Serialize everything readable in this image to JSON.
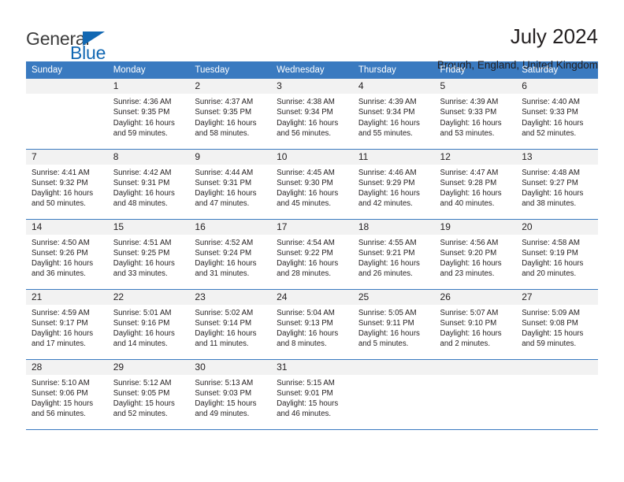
{
  "brand": {
    "name_part1": "General",
    "name_part2": "Blue",
    "triangle_color": "#1268b3"
  },
  "header": {
    "title": "July 2024",
    "subtitle": "Brough, England, United Kingdom"
  },
  "theme": {
    "header_blue": "#3a7ac0",
    "daynum_band": "#f2f2f2",
    "text": "#231f20"
  },
  "calendar": {
    "weekday_headers": [
      "Sunday",
      "Monday",
      "Tuesday",
      "Wednesday",
      "Thursday",
      "Friday",
      "Saturday"
    ],
    "labels": {
      "sunrise": "Sunrise:",
      "sunset": "Sunset:",
      "daylight": "Daylight:"
    },
    "weeks": [
      [
        {
          "day": "",
          "blank": true,
          "sunrise": "",
          "sunset": "",
          "daylight_line1": "",
          "daylight_line2": ""
        },
        {
          "day": "1",
          "blank": false,
          "sunrise": "Sunrise: 4:36 AM",
          "sunset": "Sunset: 9:35 PM",
          "daylight_line1": "Daylight: 16 hours",
          "daylight_line2": "and 59 minutes."
        },
        {
          "day": "2",
          "blank": false,
          "sunrise": "Sunrise: 4:37 AM",
          "sunset": "Sunset: 9:35 PM",
          "daylight_line1": "Daylight: 16 hours",
          "daylight_line2": "and 58 minutes."
        },
        {
          "day": "3",
          "blank": false,
          "sunrise": "Sunrise: 4:38 AM",
          "sunset": "Sunset: 9:34 PM",
          "daylight_line1": "Daylight: 16 hours",
          "daylight_line2": "and 56 minutes."
        },
        {
          "day": "4",
          "blank": false,
          "sunrise": "Sunrise: 4:39 AM",
          "sunset": "Sunset: 9:34 PM",
          "daylight_line1": "Daylight: 16 hours",
          "daylight_line2": "and 55 minutes."
        },
        {
          "day": "5",
          "blank": false,
          "sunrise": "Sunrise: 4:39 AM",
          "sunset": "Sunset: 9:33 PM",
          "daylight_line1": "Daylight: 16 hours",
          "daylight_line2": "and 53 minutes."
        },
        {
          "day": "6",
          "blank": false,
          "sunrise": "Sunrise: 4:40 AM",
          "sunset": "Sunset: 9:33 PM",
          "daylight_line1": "Daylight: 16 hours",
          "daylight_line2": "and 52 minutes."
        }
      ],
      [
        {
          "day": "7",
          "blank": false,
          "sunrise": "Sunrise: 4:41 AM",
          "sunset": "Sunset: 9:32 PM",
          "daylight_line1": "Daylight: 16 hours",
          "daylight_line2": "and 50 minutes."
        },
        {
          "day": "8",
          "blank": false,
          "sunrise": "Sunrise: 4:42 AM",
          "sunset": "Sunset: 9:31 PM",
          "daylight_line1": "Daylight: 16 hours",
          "daylight_line2": "and 48 minutes."
        },
        {
          "day": "9",
          "blank": false,
          "sunrise": "Sunrise: 4:44 AM",
          "sunset": "Sunset: 9:31 PM",
          "daylight_line1": "Daylight: 16 hours",
          "daylight_line2": "and 47 minutes."
        },
        {
          "day": "10",
          "blank": false,
          "sunrise": "Sunrise: 4:45 AM",
          "sunset": "Sunset: 9:30 PM",
          "daylight_line1": "Daylight: 16 hours",
          "daylight_line2": "and 45 minutes."
        },
        {
          "day": "11",
          "blank": false,
          "sunrise": "Sunrise: 4:46 AM",
          "sunset": "Sunset: 9:29 PM",
          "daylight_line1": "Daylight: 16 hours",
          "daylight_line2": "and 42 minutes."
        },
        {
          "day": "12",
          "blank": false,
          "sunrise": "Sunrise: 4:47 AM",
          "sunset": "Sunset: 9:28 PM",
          "daylight_line1": "Daylight: 16 hours",
          "daylight_line2": "and 40 minutes."
        },
        {
          "day": "13",
          "blank": false,
          "sunrise": "Sunrise: 4:48 AM",
          "sunset": "Sunset: 9:27 PM",
          "daylight_line1": "Daylight: 16 hours",
          "daylight_line2": "and 38 minutes."
        }
      ],
      [
        {
          "day": "14",
          "blank": false,
          "sunrise": "Sunrise: 4:50 AM",
          "sunset": "Sunset: 9:26 PM",
          "daylight_line1": "Daylight: 16 hours",
          "daylight_line2": "and 36 minutes."
        },
        {
          "day": "15",
          "blank": false,
          "sunrise": "Sunrise: 4:51 AM",
          "sunset": "Sunset: 9:25 PM",
          "daylight_line1": "Daylight: 16 hours",
          "daylight_line2": "and 33 minutes."
        },
        {
          "day": "16",
          "blank": false,
          "sunrise": "Sunrise: 4:52 AM",
          "sunset": "Sunset: 9:24 PM",
          "daylight_line1": "Daylight: 16 hours",
          "daylight_line2": "and 31 minutes."
        },
        {
          "day": "17",
          "blank": false,
          "sunrise": "Sunrise: 4:54 AM",
          "sunset": "Sunset: 9:22 PM",
          "daylight_line1": "Daylight: 16 hours",
          "daylight_line2": "and 28 minutes."
        },
        {
          "day": "18",
          "blank": false,
          "sunrise": "Sunrise: 4:55 AM",
          "sunset": "Sunset: 9:21 PM",
          "daylight_line1": "Daylight: 16 hours",
          "daylight_line2": "and 26 minutes."
        },
        {
          "day": "19",
          "blank": false,
          "sunrise": "Sunrise: 4:56 AM",
          "sunset": "Sunset: 9:20 PM",
          "daylight_line1": "Daylight: 16 hours",
          "daylight_line2": "and 23 minutes."
        },
        {
          "day": "20",
          "blank": false,
          "sunrise": "Sunrise: 4:58 AM",
          "sunset": "Sunset: 9:19 PM",
          "daylight_line1": "Daylight: 16 hours",
          "daylight_line2": "and 20 minutes."
        }
      ],
      [
        {
          "day": "21",
          "blank": false,
          "sunrise": "Sunrise: 4:59 AM",
          "sunset": "Sunset: 9:17 PM",
          "daylight_line1": "Daylight: 16 hours",
          "daylight_line2": "and 17 minutes."
        },
        {
          "day": "22",
          "blank": false,
          "sunrise": "Sunrise: 5:01 AM",
          "sunset": "Sunset: 9:16 PM",
          "daylight_line1": "Daylight: 16 hours",
          "daylight_line2": "and 14 minutes."
        },
        {
          "day": "23",
          "blank": false,
          "sunrise": "Sunrise: 5:02 AM",
          "sunset": "Sunset: 9:14 PM",
          "daylight_line1": "Daylight: 16 hours",
          "daylight_line2": "and 11 minutes."
        },
        {
          "day": "24",
          "blank": false,
          "sunrise": "Sunrise: 5:04 AM",
          "sunset": "Sunset: 9:13 PM",
          "daylight_line1": "Daylight: 16 hours",
          "daylight_line2": "and 8 minutes."
        },
        {
          "day": "25",
          "blank": false,
          "sunrise": "Sunrise: 5:05 AM",
          "sunset": "Sunset: 9:11 PM",
          "daylight_line1": "Daylight: 16 hours",
          "daylight_line2": "and 5 minutes."
        },
        {
          "day": "26",
          "blank": false,
          "sunrise": "Sunrise: 5:07 AM",
          "sunset": "Sunset: 9:10 PM",
          "daylight_line1": "Daylight: 16 hours",
          "daylight_line2": "and 2 minutes."
        },
        {
          "day": "27",
          "blank": false,
          "sunrise": "Sunrise: 5:09 AM",
          "sunset": "Sunset: 9:08 PM",
          "daylight_line1": "Daylight: 15 hours",
          "daylight_line2": "and 59 minutes."
        }
      ],
      [
        {
          "day": "28",
          "blank": false,
          "sunrise": "Sunrise: 5:10 AM",
          "sunset": "Sunset: 9:06 PM",
          "daylight_line1": "Daylight: 15 hours",
          "daylight_line2": "and 56 minutes."
        },
        {
          "day": "29",
          "blank": false,
          "sunrise": "Sunrise: 5:12 AM",
          "sunset": "Sunset: 9:05 PM",
          "daylight_line1": "Daylight: 15 hours",
          "daylight_line2": "and 52 minutes."
        },
        {
          "day": "30",
          "blank": false,
          "sunrise": "Sunrise: 5:13 AM",
          "sunset": "Sunset: 9:03 PM",
          "daylight_line1": "Daylight: 15 hours",
          "daylight_line2": "and 49 minutes."
        },
        {
          "day": "31",
          "blank": false,
          "sunrise": "Sunrise: 5:15 AM",
          "sunset": "Sunset: 9:01 PM",
          "daylight_line1": "Daylight: 15 hours",
          "daylight_line2": "and 46 minutes."
        },
        {
          "day": "",
          "blank": true,
          "sunrise": "",
          "sunset": "",
          "daylight_line1": "",
          "daylight_line2": ""
        },
        {
          "day": "",
          "blank": true,
          "sunrise": "",
          "sunset": "",
          "daylight_line1": "",
          "daylight_line2": ""
        },
        {
          "day": "",
          "blank": true,
          "sunrise": "",
          "sunset": "",
          "daylight_line1": "",
          "daylight_line2": ""
        }
      ]
    ]
  }
}
